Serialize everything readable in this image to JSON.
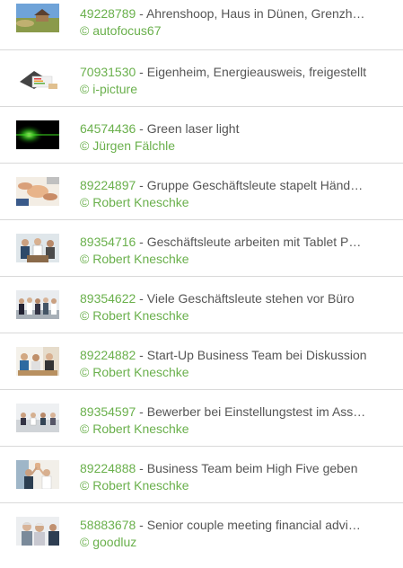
{
  "items": [
    {
      "id": "49228789",
      "title": "Ahrenshoop, Haus in Dünen, Grenzh…",
      "author": "© autofocus67",
      "thumb_icon": "dune-house-photo"
    },
    {
      "id": "70931530",
      "title": "Eigenheim, Energieausweis, freigestellt",
      "author": "© i-picture",
      "thumb_icon": "house-energy-certificate-photo"
    },
    {
      "id": "64574436",
      "title": "Green laser light",
      "author": "© Jürgen Fälchle",
      "thumb_icon": "green-laser-photo"
    },
    {
      "id": "89224897",
      "title": "Gruppe Geschäftsleute stapelt Händ…",
      "author": "© Robert Kneschke",
      "thumb_icon": "stacked-hands-photo"
    },
    {
      "id": "89354716",
      "title": "Geschäftsleute arbeiten mit Tablet P…",
      "author": "© Robert Kneschke",
      "thumb_icon": "business-tablet-photo"
    },
    {
      "id": "89354622",
      "title": "Viele Geschäftsleute stehen vor Büro",
      "author": "© Robert Kneschke",
      "thumb_icon": "business-group-photo"
    },
    {
      "id": "89224882",
      "title": "Start-Up Business Team bei Diskussion",
      "author": "© Robert Kneschke",
      "thumb_icon": "startup-team-photo"
    },
    {
      "id": "89354597",
      "title": "Bewerber bei Einstellungstest im Ass…",
      "author": "© Robert Kneschke",
      "thumb_icon": "assessment-center-photo"
    },
    {
      "id": "89224888",
      "title": "Business Team beim High Five geben",
      "author": "© Robert Kneschke",
      "thumb_icon": "high-five-photo"
    },
    {
      "id": "58883678",
      "title": "Senior couple meeting financial advi…",
      "author": "© goodluz",
      "thumb_icon": "senior-couple-photo"
    }
  ],
  "separator": " - ",
  "colors": {
    "accent_green": "#6ab04c",
    "text_gray": "#555555",
    "divider": "#d9d9d9"
  }
}
